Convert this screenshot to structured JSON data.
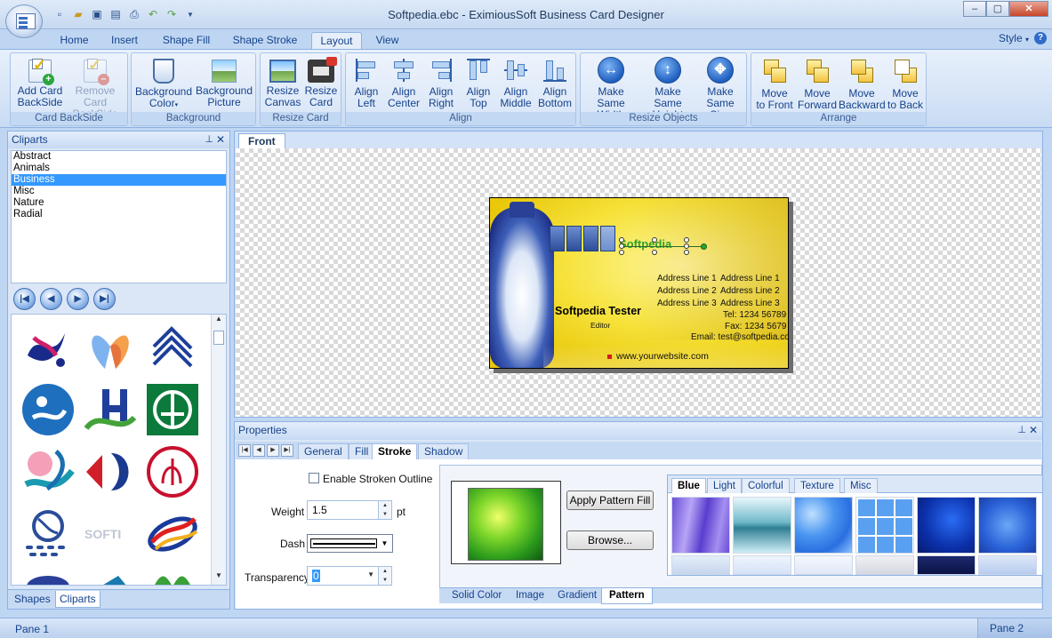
{
  "window": {
    "title": "Softpedia.ebc - EximiousSoft Business Card Designer"
  },
  "qat": {
    "icons": [
      "new-icon",
      "open-icon",
      "save-icon",
      "save-as-icon",
      "print-icon",
      "undo-icon",
      "redo-icon",
      "customize-icon"
    ]
  },
  "ribbon_tabs": [
    "Home",
    "Insert",
    "Shape Fill",
    "Shape Stroke",
    "Layout",
    "View"
  ],
  "active_tab": "Layout",
  "style_menu": "Style",
  "groups": {
    "card_backside": {
      "label": "Card BackSide",
      "add": "Add Card BackSide",
      "add_l1": "Add Card",
      "add_l2": "BackSide",
      "remove_l1": "Remove Card",
      "remove_l2": "BackSide"
    },
    "background": {
      "label": "Background",
      "color_l1": "Background",
      "color_l2": "Color",
      "picture_l1": "Background",
      "picture_l2": "Picture"
    },
    "resize_card": {
      "label": "Resize Card",
      "canvas_l1": "Resize",
      "canvas_l2": "Canvas",
      "card_l1": "Resize",
      "card_l2": "Card"
    },
    "align": {
      "label": "Align",
      "left_l1": "Align",
      "left_l2": "Left",
      "center_l1": "Align",
      "center_l2": "Center",
      "right_l1": "Align",
      "right_l2": "Right",
      "top_l1": "Align",
      "top_l2": "Top",
      "middle_l1": "Align",
      "middle_l2": "Middle",
      "bottom_l1": "Align",
      "bottom_l2": "Bottom"
    },
    "resize_objects": {
      "label": "Resize Objects",
      "w_l1": "Make Same",
      "w_l2": "Width",
      "h_l1": "Make Same",
      "h_l2": "Height",
      "s_l1": "Make",
      "s_l2": "Same Size"
    },
    "arrange": {
      "label": "Arrange",
      "front_l1": "Move",
      "front_l2": "to Front",
      "fwd_l1": "Move",
      "fwd_l2": "Forward",
      "bwd_l1": "Move",
      "bwd_l2": "Backward",
      "back_l1": "Move",
      "back_l2": "to Back"
    }
  },
  "cliparts": {
    "title": "Cliparts",
    "categories": [
      "Abstract",
      "Animals",
      "Business",
      "Misc",
      "Nature",
      "Radial"
    ],
    "selected": "Business",
    "bottom_tabs": [
      "Shapes",
      "Cliparts"
    ],
    "active_bottom_tab": "Cliparts"
  },
  "design": {
    "tab": "Front",
    "card": {
      "logo_text": "Softpedia",
      "address_left": [
        "Address Line 1",
        "Address Line 2",
        "Address Line 3"
      ],
      "address_right": [
        "Address Line 1",
        "Address Line 2",
        "Address Line 3"
      ],
      "tel": "Tel: 1234 56789",
      "fax": "Fax: 1234 5679",
      "email": "Email: test@softpedia.com",
      "name": "Softpedia Tester",
      "job_title": "Editor",
      "website": "www.yourwebsite.com"
    }
  },
  "properties": {
    "title": "Properties",
    "tabs": [
      "General",
      "Fill",
      "Stroke",
      "Shadow"
    ],
    "active_tab": "Stroke",
    "enable_outline": "Enable Stroken Outline",
    "weight_label": "Weight",
    "weight_value": "1.5",
    "weight_unit": "pt",
    "dash_label": "Dash",
    "transparency_label": "Transparency",
    "transparency_value": "0",
    "apply_pattern": "Apply Pattern Fill",
    "browse": "Browse...",
    "swatch_tabs": [
      "Blue",
      "Light",
      "Colorful",
      "Texture",
      "Misc"
    ],
    "active_swatch_tab": "Blue",
    "fill_tabs": [
      "Solid Color",
      "Image",
      "Gradient",
      "Pattern"
    ],
    "active_fill_tab": "Pattern"
  },
  "status": {
    "pane1": "Pane 1",
    "pane2": "Pane 2"
  }
}
